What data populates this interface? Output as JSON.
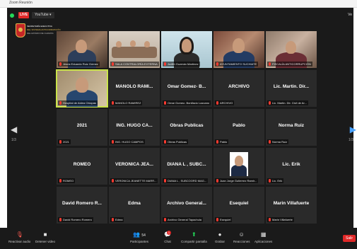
{
  "window": {
    "title": "Zoom Reunión"
  },
  "header": {
    "live_label": "LIVE",
    "stream_target": "YouTube ▾",
    "view_label": "Ve"
  },
  "logo": {
    "line1": "SECRETARÍA EJECUTIVA",
    "line2": "DEL SISTEMA ANTICORRUPCIÓN",
    "line3": "DEL ESTADO DE CHIAPAS"
  },
  "pagination": {
    "left": "1/3",
    "right": "1/3"
  },
  "tiles": [
    {
      "name": "",
      "caption": "Jesús Eduardo Ruiz Gómez"
    },
    {
      "name": "",
      "caption": "SALA CONTRALORÍA EXTERNA"
    },
    {
      "name": "",
      "caption": "Judith Guzmán Martínez"
    },
    {
      "name": "",
      "caption": "AYUNTAMIENTO SUCHIATE"
    },
    {
      "name": "",
      "caption": "FISCALÍA ANTICORRUPCIÓN"
    },
    {
      "name": "",
      "caption": "Hospital de Aldea Chiapas"
    },
    {
      "name": "MANOLO RAMI...",
      "caption": "MANOLO RAMIREZ"
    },
    {
      "name": "Omar Gomez- B...",
      "caption": "Omar Gomez- Bonifacio Lazcano"
    },
    {
      "name": "ARCHIVO",
      "caption": "ARCHIVO"
    },
    {
      "name": "Lic. Martin. Dir...",
      "caption": "Lic. Martin. Dir. Civil de Ar..."
    },
    {
      "name": "2021",
      "caption": "2021"
    },
    {
      "name": "ING. HUGO CA...",
      "caption": "ING. HUGO CAMPOS"
    },
    {
      "name": "Obras Publicas",
      "caption": "Obras Publicas"
    },
    {
      "name": "Pablo",
      "caption": "Pablo"
    },
    {
      "name": "Norma Ruiz",
      "caption": "Norma Ruiz"
    },
    {
      "name": "ROMEO",
      "caption": "ROMEO"
    },
    {
      "name": "VERONICA JEA...",
      "caption": "VERONICA JEANETTE MARR..."
    },
    {
      "name": "DIANA L , SUBC...",
      "caption": "DIANA L , SUBCOORD MAG..."
    },
    {
      "name": "",
      "caption": "Juan Jorge Gutierrez Ramir..."
    },
    {
      "name": "Lic. Erik",
      "caption": "Lic. Erik"
    },
    {
      "name": "David Romero R...",
      "caption": "David Romero Romero"
    },
    {
      "name": "Edma",
      "caption": "Edma"
    },
    {
      "name": "Archivo General...",
      "caption": "Archivo General Tapachula"
    },
    {
      "name": "Esequiel",
      "caption": "Esequiel"
    },
    {
      "name": "Marin Villafuerte",
      "caption": "Marin Villafuerte"
    }
  ],
  "toolbar": {
    "audio": "Reactivar audio",
    "video": "Detener video",
    "participants": "Participantes",
    "participants_count": "54",
    "chat": "Chat",
    "chat_badge": "1",
    "share": "Compartir pantalla",
    "record": "Grabar",
    "reactions": "Reacciones",
    "apps": "Aplicaciones",
    "leave": "Salir"
  },
  "colors": {
    "live": "#e02828",
    "active_speaker": "#c9e34a",
    "share": "#23d959",
    "mic_muted": "#ff3b30"
  }
}
